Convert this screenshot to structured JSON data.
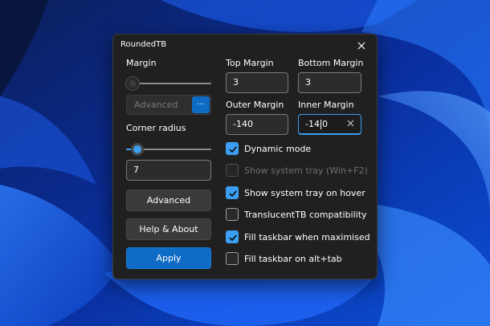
{
  "window": {
    "title": "RoundedTB"
  },
  "left": {
    "margin_label": "Margin",
    "margin_slider_value": 0,
    "advanced_combo_text": "Advanced",
    "advanced_combo_button": "...",
    "corner_radius_label": "Corner radius",
    "corner_radius_slider_value": 0.07,
    "corner_radius_value": "7",
    "advanced_button": "Advanced",
    "help_button": "Help & About",
    "apply_button": "Apply"
  },
  "right": {
    "top_margin_label": "Top Margin",
    "top_margin_value": "3",
    "bottom_margin_label": "Bottom Margin",
    "bottom_margin_value": "3",
    "outer_margin_label": "Outer Margin",
    "outer_margin_value": "-140",
    "inner_margin_label": "Inner Margin",
    "inner_margin_value_a": "-14",
    "inner_margin_value_b": "0"
  },
  "checkboxes": [
    {
      "label": "Dynamic mode",
      "checked": true,
      "enabled": true
    },
    {
      "label": "Show system tray (Win+F2)",
      "checked": false,
      "enabled": false
    },
    {
      "label": "Show system tray on hover",
      "checked": true,
      "enabled": true
    },
    {
      "label": "TranslucentTB compatibility",
      "checked": false,
      "enabled": true
    },
    {
      "label": "Fill taskbar when maximised",
      "checked": true,
      "enabled": true
    },
    {
      "label": "Fill taskbar on alt+tab",
      "checked": false,
      "enabled": true
    }
  ],
  "icons": {
    "close": "close-icon",
    "check": "checkmark-icon",
    "clear": "clear-icon"
  },
  "colors": {
    "accent": "#3b9ef0",
    "primary_button": "#0f6cc5",
    "dialog_bg": "#202020"
  }
}
